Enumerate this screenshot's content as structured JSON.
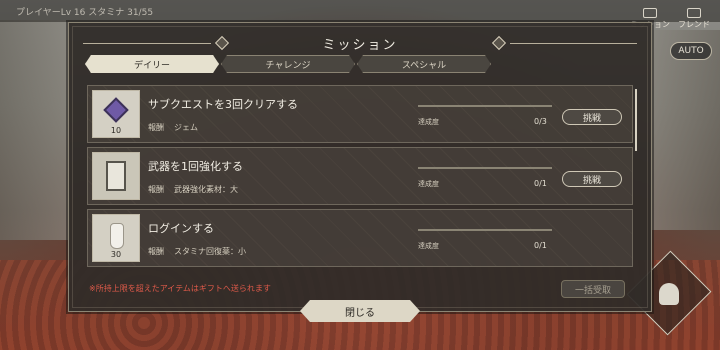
{
  "hud": {
    "status_text": "プレイヤーLv 16  スタミナ 31/55",
    "nav": [
      {
        "label": "ミッション",
        "icon": "mission-icon"
      },
      {
        "label": "フレンド",
        "icon": "friend-icon"
      }
    ],
    "auto_label": "AUTO"
  },
  "modal": {
    "title": "ミッション",
    "tabs": [
      {
        "label": "デイリー",
        "active": true
      },
      {
        "label": "チャレンジ",
        "active": false
      },
      {
        "label": "スペシャル",
        "active": false
      }
    ],
    "missions": [
      {
        "title": "サブクエストを3回クリアする",
        "reward_label": "報酬",
        "reward": "ジェム",
        "item_count": "10",
        "progress_label": "達成度",
        "progress_text": "0/3",
        "progress": 0,
        "button": "挑戦",
        "icon": "gem-icon"
      },
      {
        "title": "武器を1回強化する",
        "reward_label": "報酬",
        "reward": "武器強化素材：大",
        "item_count": "",
        "progress_label": "達成度",
        "progress_text": "0/1",
        "progress": 0,
        "button": "挑戦",
        "icon": "weapon-material-icon"
      },
      {
        "title": "ログインする",
        "reward_label": "報酬",
        "reward": "スタミナ回復薬：小",
        "item_count": "30",
        "progress_label": "達成度",
        "progress_text": "0/1",
        "progress": 0,
        "button": "",
        "icon": "stamina-potion-icon"
      }
    ],
    "notice": "※所持上限を超えたアイテムはギフトへ送られます",
    "bulk_receive": "一括受取",
    "close": "閉じる"
  },
  "colors": {
    "notice": "#e05a4a",
    "active_tab": "#e6e1cf",
    "panel": "#302c28"
  }
}
